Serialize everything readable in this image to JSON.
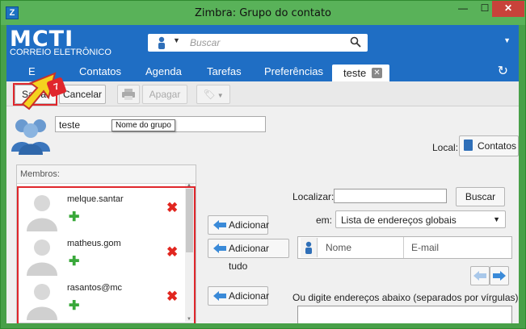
{
  "window": {
    "title": "Zimbra: Grupo do contato",
    "app_icon": "Z"
  },
  "header": {
    "logo": "MCTI",
    "logo_sub": "CORREIO ELETRÔNICO",
    "search_placeholder": "Buscar"
  },
  "tabs": [
    {
      "label": "E"
    },
    {
      "label": "Contatos"
    },
    {
      "label": "Agenda"
    },
    {
      "label": "Tarefas"
    },
    {
      "label": "Preferências"
    },
    {
      "label": "teste",
      "active": true
    }
  ],
  "toolbar": {
    "save": "Salvar",
    "cancel": "Cancelar",
    "delete": "Apagar"
  },
  "group": {
    "name": "teste",
    "tooltip": "Nome do grupo",
    "local_label": "Local:",
    "local_value": "Contatos"
  },
  "members": {
    "header": "Membros:",
    "items": [
      {
        "name": "melque.santar"
      },
      {
        "name": "matheus.gom"
      },
      {
        "name": "rasantos@mc"
      }
    ]
  },
  "actions": {
    "add": "Adicionar",
    "add_all": "Adicionar tudo",
    "add2": "Adicionar"
  },
  "search_panel": {
    "find_label": "Localizar:",
    "find_button": "Buscar",
    "in_label": "em:",
    "in_value": "Lista de endereços globais",
    "col_name": "Nome",
    "col_email": "E-mail",
    "manual_label": "Ou digite endereços abaixo (separados por vírgulas)"
  },
  "callout": {
    "step": "7"
  },
  "colors": {
    "accent": "#1f6ec4",
    "highlight": "#e0262c",
    "frame": "#59b259"
  }
}
